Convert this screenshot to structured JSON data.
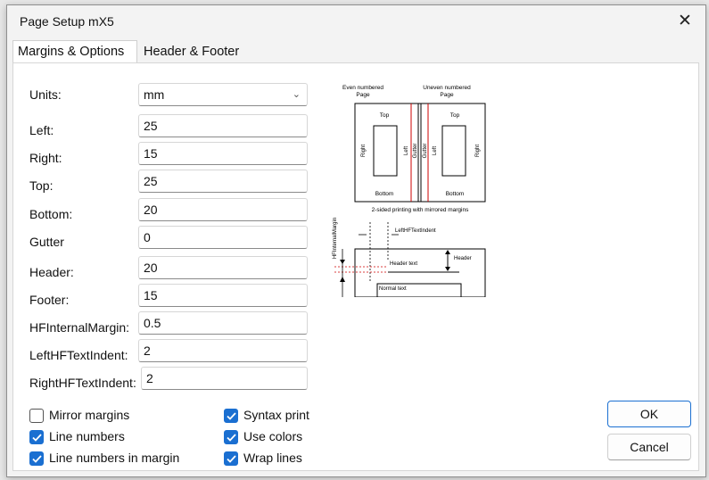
{
  "window": {
    "title": "Page Setup mX5",
    "close_glyph": "✕"
  },
  "tabs": [
    {
      "label": "Margins & Options",
      "active": true
    },
    {
      "label": "Header & Footer",
      "active": false
    }
  ],
  "units": {
    "label": "Units:",
    "value": "mm"
  },
  "fields": [
    {
      "label": "Left:",
      "value": "25"
    },
    {
      "label": "Right:",
      "value": "15"
    },
    {
      "label": "Top:",
      "value": "25"
    },
    {
      "label": "Bottom:",
      "value": "20"
    },
    {
      "label": "Gutter",
      "value": "0"
    },
    {
      "label": "Header:",
      "value": "20"
    },
    {
      "label": "Footer:",
      "value": "15"
    },
    {
      "label": "HFInternalMargin:",
      "value": "0.5"
    },
    {
      "label": "LeftHFTextIndent:",
      "value": "2"
    },
    {
      "label": "RightHFTextIndent:",
      "value": "2"
    }
  ],
  "checkboxes": [
    {
      "label": "Mirror margins",
      "checked": false
    },
    {
      "label": "Line numbers",
      "checked": true
    },
    {
      "label": "Line numbers in margin",
      "checked": true
    },
    {
      "label": "Syntax print",
      "checked": true
    },
    {
      "label": "Use colors",
      "checked": true
    },
    {
      "label": "Wrap lines",
      "checked": true
    }
  ],
  "buttons": {
    "ok": "OK",
    "cancel": "Cancel"
  },
  "preview": {
    "even_line1": "Even numbered",
    "even_line2": "Page",
    "uneven_line1": "Uneven numbered",
    "uneven_line2": "Page",
    "top": "Top",
    "bottom": "Bottom",
    "left": "Left",
    "right": "Right",
    "gutter": "Gutter",
    "caption": "2-sided printing with mirrored margins",
    "hf_internal_margin": "HFInternalMargin",
    "left_hf_indent": "LeftHFTextIndent",
    "header": "Header",
    "header_text": "Header text",
    "normal_text": "Normal text"
  },
  "colors": {
    "accent": "#1a6fd1",
    "margin_line": "#cc0000"
  }
}
